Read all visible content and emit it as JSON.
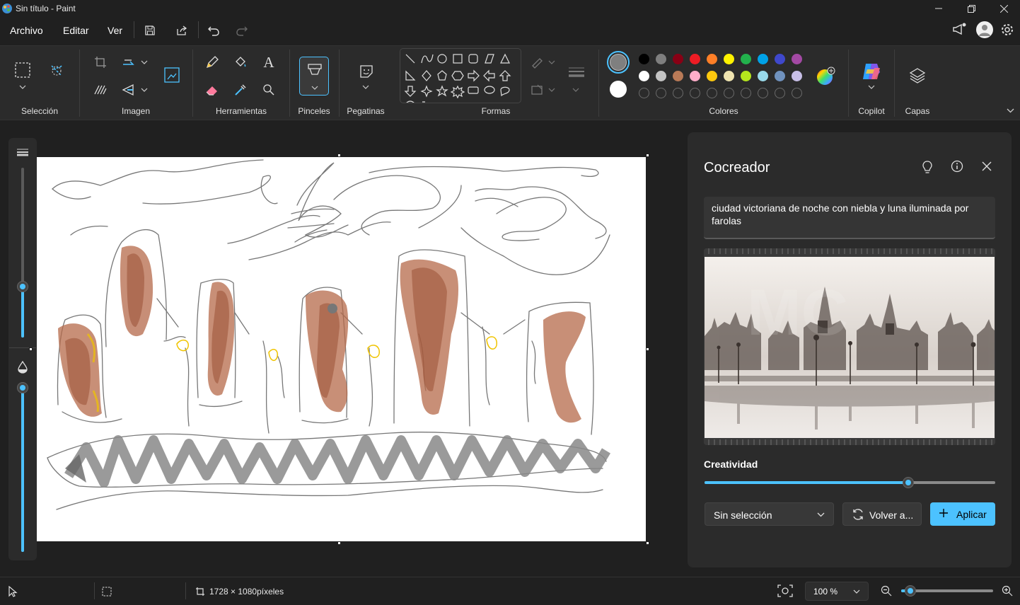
{
  "window": {
    "title": "Sin título - Paint"
  },
  "menu": {
    "file": "Archivo",
    "edit": "Editar",
    "view": "Ver"
  },
  "ribbon": {
    "groups": {
      "selection": "Selección",
      "image": "Imagen",
      "tools": "Herramientas",
      "brushes": "Pinceles",
      "stickers": "Pegatinas",
      "shapes": "Formas",
      "colors": "Colores",
      "copilot": "Copilot",
      "layers": "Capas"
    },
    "text_tool_glyph": "A",
    "active_color": "#7f7f7f",
    "secondary_color": "#ffffff",
    "palette_row1": [
      "#000000",
      "#7f7f7f",
      "#880015",
      "#ed1c24",
      "#ff7f27",
      "#fff200",
      "#22b14c",
      "#00a2e8",
      "#3f48cc",
      "#a349a4"
    ],
    "palette_row2": [
      "#ffffff",
      "#c3c3c3",
      "#b97a57",
      "#ffaec9",
      "#ffc90e",
      "#efe4b0",
      "#b5e61d",
      "#99d9ea",
      "#7092be",
      "#c8bfe7"
    ]
  },
  "cocreator": {
    "title": "Cocreador",
    "prompt": "ciudad victoriana de noche con niebla y luna iluminada por farolas",
    "creativity_label": "Creatividad",
    "creativity_value": 0.7,
    "style_select": "Sin selección",
    "regenerate_label": "Volver a...",
    "apply_label": "Aplicar"
  },
  "status": {
    "canvas_size": "1728 × 1080píxeles",
    "zoom": "100 %",
    "zoom_level": 0.1
  },
  "brush": {
    "size_level": 0.3,
    "opacity_level": 1.0
  }
}
